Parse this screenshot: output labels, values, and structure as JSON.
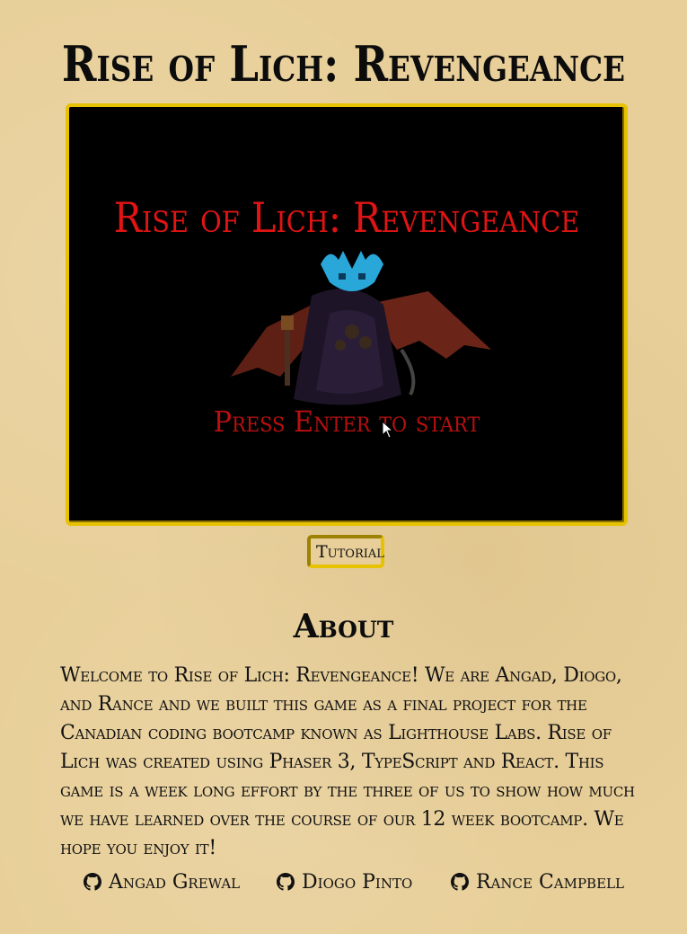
{
  "page": {
    "title": "Rise of Lich: Revengeance"
  },
  "game": {
    "title": "Rise of Lich: Revengeance",
    "prompt": "Press Enter to start",
    "art": "lich-boss-sprite"
  },
  "tutorial": {
    "label": "Tutorial"
  },
  "about": {
    "heading": "About",
    "text": "Welcome to Rise of Lich: Revengeance! We are Angad, Diogo, and Rance and we built this game as a final project for the Canadian coding bootcamp known as Lighthouse Labs. Rise of Lich was created using Phaser 3, TypeScript and React. This game is a week long effort by the three of us to show how much we have learned over the course of our 12 week bootcamp. We hope you enjoy it!"
  },
  "credits": [
    {
      "name": "Angad Grewal",
      "icon": "github-icon"
    },
    {
      "name": "Diogo Pinto",
      "icon": "github-icon"
    },
    {
      "name": "Rance Campbell",
      "icon": "github-icon"
    }
  ],
  "colors": {
    "background": "#e8cf99",
    "frame_border": "#e6c200",
    "game_title": "#e01414",
    "prompt": "#b81010"
  }
}
